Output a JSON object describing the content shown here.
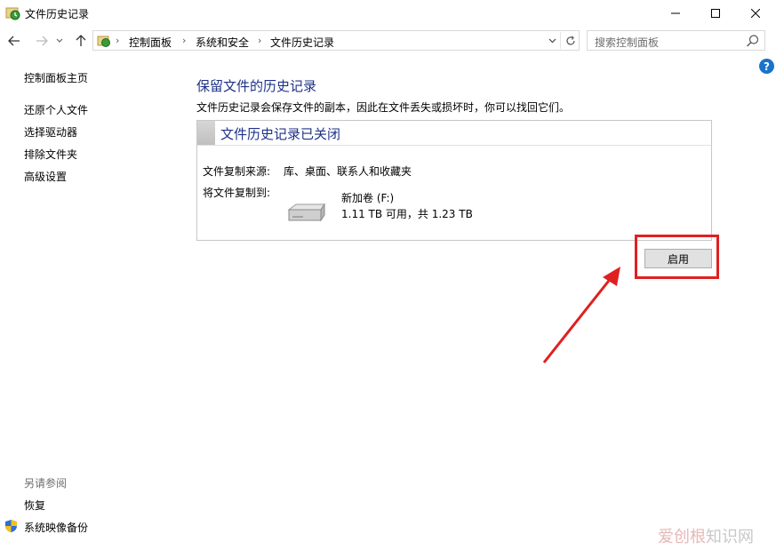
{
  "window": {
    "title": "文件历史记录"
  },
  "breadcrumb": {
    "items": [
      "控制面板",
      "系统和安全",
      "文件历史记录"
    ]
  },
  "search": {
    "placeholder": "搜索控制面板"
  },
  "sidebar": {
    "home": "控制面板主页",
    "links": [
      "还原个人文件",
      "选择驱动器",
      "排除文件夹",
      "高级设置"
    ],
    "see_also": "另请参阅",
    "see_also_links": [
      "恢复",
      "系统映像备份"
    ]
  },
  "main": {
    "title": "保留文件的历史记录",
    "description": "文件历史记录会保存文件的副本，因此在文件丢失或损坏时，你可以找回它们。",
    "status_title": "文件历史记录已关闭",
    "source_label": "文件复制来源:",
    "source_value": "库、桌面、联系人和收藏夹",
    "dest_label": "将文件复制到:",
    "drive_name": "新加卷 (F:)",
    "drive_space": "1.11 TB 可用，共 1.23 TB",
    "enable_button": "启用"
  },
  "watermark": {
    "part1": "爱创根",
    "part2": "知识网"
  },
  "colors": {
    "link_blue": "#1e3287",
    "highlight_red": "#e02020",
    "help_blue": "#1a73c9"
  }
}
